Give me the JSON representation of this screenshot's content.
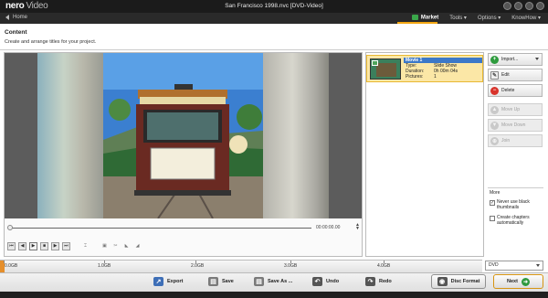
{
  "app": {
    "logo_main": "nero",
    "logo_sub": "Video",
    "window_title": "San Francisco 1998.nvc [DVD-Video]"
  },
  "nav": {
    "home": "Home",
    "market": "Market",
    "tools": "Tools ▾",
    "options": "Options ▾",
    "knowhow": "KnowHow ▾"
  },
  "content": {
    "title": "Content",
    "subtitle": "Create and arrange titles for your project."
  },
  "player": {
    "timecode": "00:00:00.00",
    "spin": "▲\n▼"
  },
  "title_list": [
    {
      "name": "Movie 1",
      "type_label": "Type:",
      "type_value": "Slide Show",
      "duration_label": "Duration:",
      "duration_value": "0h 00m 04s",
      "pictures_label": "Pictures:",
      "pictures_value": "1"
    }
  ],
  "actions": {
    "import": "Import...",
    "edit": "Edit",
    "delete": "Delete",
    "move_up": "Move Up",
    "move_down": "Move Down",
    "join": "Join"
  },
  "more": {
    "title": "More",
    "never_black": "Never use black thumbnails",
    "never_black_checked": true,
    "create_chapters": "Create chapters automatically",
    "create_chapters_checked": false
  },
  "capacity": {
    "ticks": [
      "0.0GB",
      "1.0GB",
      "2.0GB",
      "3.0GB",
      "4.0GB"
    ],
    "used_fraction": 0.01,
    "disc_type": "DVD"
  },
  "toolbar": {
    "export": "Export",
    "save": "Save",
    "save_as": "Save As ...",
    "undo": "Undo",
    "redo": "Redo",
    "disc_format": "Disc Format",
    "next": "Next"
  },
  "colors": {
    "accent": "#f3a612",
    "selection": "#fbe7a6",
    "title_highlight": "#3c78c8"
  }
}
